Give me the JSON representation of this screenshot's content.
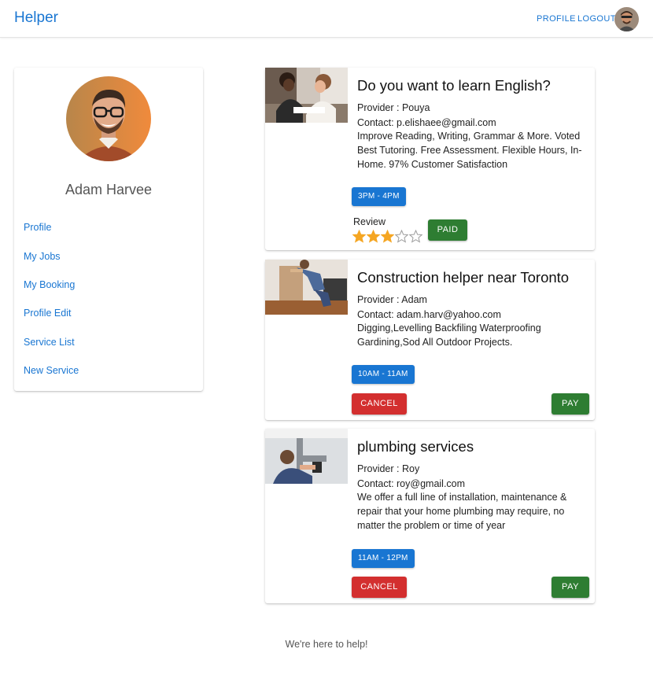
{
  "header": {
    "brand": "Helper",
    "nav": {
      "profile": "PROFILE",
      "logout": "LOGOUT"
    }
  },
  "sidebar": {
    "user_name": "Adam Harvee",
    "links": [
      "Profile",
      "My Jobs",
      "My Booking",
      "Profile Edit",
      "Service List",
      "New Service"
    ]
  },
  "services": [
    {
      "title": "Do you want to learn English?",
      "provider": "Provider : Pouya",
      "contact": "Contact: p.elishaee@gmail.com",
      "description": "Improve Reading, Writing, Grammar & More. Voted Best Tutoring. Free Assessment. Flexible Hours, In-Home. 97% Customer Satisfaction",
      "time": "3PM - 4PM",
      "review_label": "Review",
      "rating": 3,
      "rating_max": 5,
      "status_label": "PAID"
    },
    {
      "title": "Construction helper near Toronto",
      "provider": "Provider : Adam",
      "contact": "Contact: adam.harv@yahoo.com",
      "description": "Digging,Levelling Backfiling Waterproofing Gardining,Sod All Outdoor Projects.",
      "time": "10AM - 11AM",
      "cancel_label": "CANCEL",
      "pay_label": "PAY"
    },
    {
      "title": "plumbing services",
      "provider": "Provider : Roy",
      "contact": "Contact: roy@gmail.com",
      "description": "We offer a full line of installation, maintenance & repair that your home plumbing may require, no matter the problem or time of year",
      "time": "11AM - 12PM",
      "cancel_label": "CANCEL",
      "pay_label": "PAY"
    }
  ],
  "footer": {
    "text": "We're here to help!"
  },
  "colors": {
    "primary": "#1976d2",
    "danger": "#d32f2f",
    "success": "#2e7d32",
    "star": "#f5a623"
  },
  "icons": {
    "star_filled": "star-filled-icon",
    "star_empty": "star-outline-icon"
  }
}
